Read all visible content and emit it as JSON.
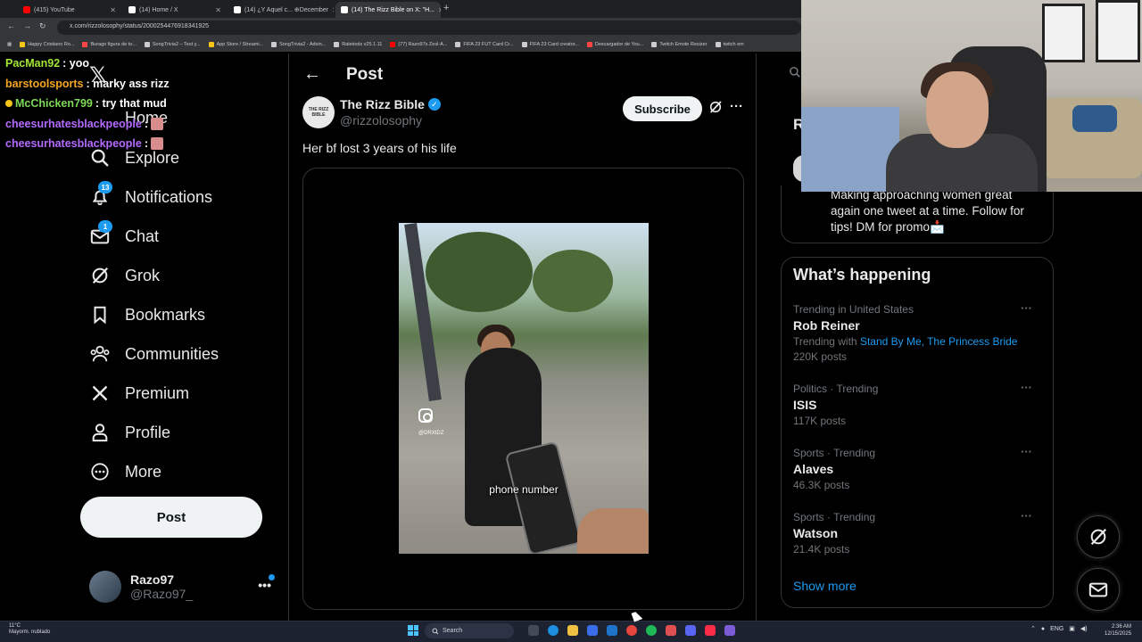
{
  "browser": {
    "tabs": [
      {
        "label": "(415) YouTube",
        "fav": "#ff0000"
      },
      {
        "label": "(14) Home / X",
        "fav": "#ffffff"
      },
      {
        "label": "(14) ¿Y Aquel c... ⊕December",
        "fav": "#ffffff"
      },
      {
        "label": "(14) The Rizz Bible on X: \"H...",
        "fav": "#ffffff"
      }
    ],
    "url": "x.com/rizzolosophy/status/2000254476918341925",
    "bookmarks": [
      {
        "label": "Happy Cristiano Ro...",
        "color": "#f5c518"
      },
      {
        "label": "Burago figura de to...",
        "color": "#ff4444"
      },
      {
        "label": "SongTrivia2 – Test y...",
        "color": "#cccccc"
      },
      {
        "label": "App Store / Streami...",
        "color": "#f5c518"
      },
      {
        "label": "SongTrivia2 - Advin...",
        "color": "#cccccc"
      },
      {
        "label": "Raletools v25.1.11",
        "color": "#cccccc"
      },
      {
        "label": "(77) Razo97s Zesl-A...",
        "color": "#ff0000"
      },
      {
        "label": "FIFA 23 FUT Card Cr...",
        "color": "#cccccc"
      },
      {
        "label": "FIFA 23 Card creator...",
        "color": "#cccccc"
      },
      {
        "label": "Descargador de You...",
        "color": "#ff4444"
      },
      {
        "label": "Twitch Emote Resizer",
        "color": "#cccccc"
      },
      {
        "label": "twitch em",
        "color": "#cccccc"
      }
    ]
  },
  "chat": [
    {
      "user": "PacMan92",
      "color": "#a3e635",
      "msg": ": yoo",
      "emote": false
    },
    {
      "user": "barstoolsports",
      "color": "#f5a623",
      "msg": ": marky ass rizz",
      "emote": false
    },
    {
      "user": "McChicken799",
      "color": "#7ed957",
      "msg": ": try that mud",
      "emote": false
    },
    {
      "user": "cheesurhatesblackpeople",
      "color": "#b36bff",
      "msg": ":",
      "emote": true
    },
    {
      "user": "cheesurhatesblackpeople",
      "color": "#b36bff",
      "msg": ":",
      "emote": true
    }
  ],
  "nav": {
    "home_partial": "Home",
    "items": [
      {
        "label": "Explore",
        "icon": "search-icon",
        "badge": ""
      },
      {
        "label": "Notifications",
        "icon": "bell-icon",
        "badge": "13"
      },
      {
        "label": "Chat",
        "icon": "mail-icon",
        "badge": "1"
      },
      {
        "label": "Grok",
        "icon": "grok-icon",
        "badge": ""
      },
      {
        "label": "Bookmarks",
        "icon": "bookmark-icon",
        "badge": ""
      },
      {
        "label": "Communities",
        "icon": "people-icon",
        "badge": ""
      },
      {
        "label": "Premium",
        "icon": "x-icon",
        "badge": ""
      },
      {
        "label": "Profile",
        "icon": "user-icon",
        "badge": ""
      },
      {
        "label": "More",
        "icon": "more-circle-icon",
        "badge": ""
      }
    ],
    "post_label": "Post",
    "account": {
      "name": "Razo97",
      "handle": "@Razo97_"
    }
  },
  "post": {
    "header_title": "Post",
    "author_name": "The Rizz Bible",
    "author_handle": "@rizzolosophy",
    "avatar_text": "THE RIZZ BIBLE",
    "subscribe_label": "Subscribe",
    "text": "Her bf lost 3 years of his life",
    "video_caption": "phone number",
    "video_watermark": "@DRXIDZ"
  },
  "sidebar": {
    "r_partial": "R",
    "promo": "Making approaching women great again one tweet at a time. Follow for tips! DM for promo📩",
    "happening_title": "What’s happening",
    "trends": [
      {
        "meta": "Trending in United States",
        "name": "Rob Reiner",
        "with_prefix": "Trending with",
        "with_links": "Stand By Me, The Princess Bride",
        "count": "220K posts"
      },
      {
        "meta": "Politics · Trending",
        "name": "ISIS",
        "with_prefix": "",
        "with_links": "",
        "count": "117K posts"
      },
      {
        "meta": "Sports · Trending",
        "name": "Alaves",
        "with_prefix": "",
        "with_links": "",
        "count": "46.3K posts"
      },
      {
        "meta": "Sports · Trending",
        "name": "Watson",
        "with_prefix": "",
        "with_links": "",
        "count": "21.4K posts"
      }
    ],
    "show_more": "Show more"
  },
  "taskbar": {
    "weather_temp": "11°C",
    "weather_desc": "Mayorm. nublado",
    "search_label": "Search",
    "lang": "ENG",
    "time": "2:36 AM",
    "date": "12/15/2025"
  }
}
